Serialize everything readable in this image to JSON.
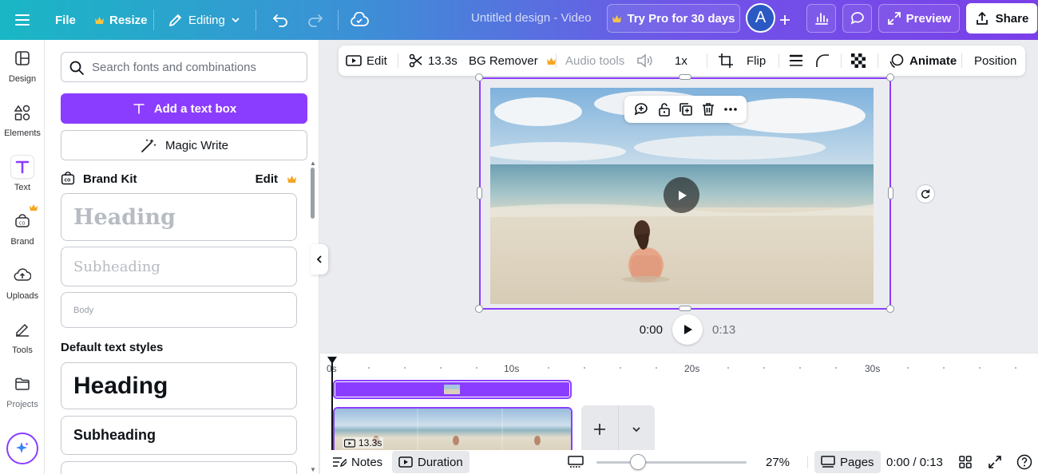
{
  "topbar": {
    "file": "File",
    "resize": "Resize",
    "editing": "Editing",
    "doc_title": "Untitled design - Video",
    "try_pro": "Try Pro for 30 days",
    "avatar_letter": "A",
    "preview": "Preview",
    "share": "Share"
  },
  "rail": {
    "design": "Design",
    "elements": "Elements",
    "text": "Text",
    "brand": "Brand",
    "uploads": "Uploads",
    "tools": "Tools",
    "projects": "Projects"
  },
  "panel": {
    "search_placeholder": "Search fonts and combinations",
    "add_text_box": "Add a text box",
    "magic_write": "Magic Write",
    "brand_kit": "Brand Kit",
    "brand_kit_edit": "Edit",
    "brand_heading": "Heading",
    "brand_subheading": "Subheading",
    "brand_body": "Body",
    "default_styles_label": "Default text styles",
    "default_heading": "Heading",
    "default_subheading": "Subheading"
  },
  "toolbar": {
    "edit": "Edit",
    "duration": "13.3s",
    "bg_remover": "BG Remover",
    "audio_tools": "Audio tools",
    "speed": "1x",
    "flip": "Flip",
    "animate": "Animate",
    "position": "Position"
  },
  "player": {
    "current_time": "0:00",
    "total_time": "0:13"
  },
  "timeline": {
    "ticks": [
      "0s",
      "10s",
      "20s",
      "30s"
    ],
    "clip_duration": "13.3s"
  },
  "bottombar": {
    "notes": "Notes",
    "duration": "Duration",
    "zoom": "27%",
    "pages": "Pages",
    "time_readout": "0:00 / 0:13"
  },
  "colors": {
    "accent": "#8b3dff",
    "crown": "#f5a623"
  }
}
